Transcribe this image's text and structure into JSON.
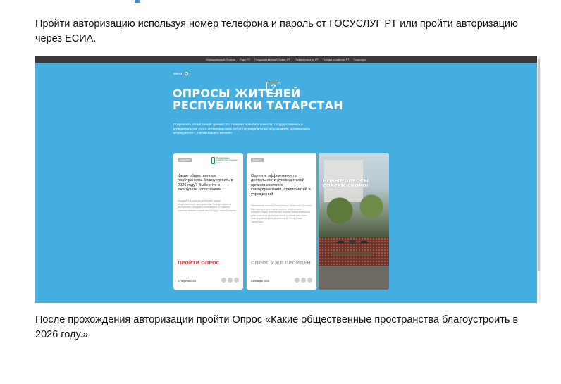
{
  "intro_text": "Пройти авторизацию используя номер телефона и пароль от ГОСУСЛУГ РТ или пройти авторизацию через ЕСИА.",
  "outro_text": "После прохождения авторизации пройти Опрос «Какие общественные пространства благоустроить в 2026 году.»",
  "site": {
    "nav": [
      "Официальный Портал",
      "Раис РТ",
      "Государственный Совет РТ",
      "Правительство РТ",
      "Города и районы РТ",
      "Госуслуги"
    ],
    "breadcrumb": "Меню",
    "title_line1": "ОПРОСЫ ЖИТЕЛЕЙ",
    "title_line2": "РЕСПУБЛИКИ ТАТАРСТАН",
    "bubble_icon_glyph": "?",
    "subtitle": "Поделитесь своей точкой зрения! Это поможет повысить качество государственных и муниципальных услуг, оптимизировать работу муниципальных образований, организовать мероприятия с учетом вашего мнения!"
  },
  "cards": [
    {
      "tag": "Госуслуги",
      "org": "Формирование комфортной городской среды",
      "title": "Какие общественные пространства благоустроить в 2026 году? Выберите в ежегодном голосовании.",
      "desc": "Каждый год жители выбирают, какие общественные пространства благоустроить в республике. Каждый голос важен: от вашего участия зависит, какие места будут преображены.",
      "cta": "ПРОЙТИ ОПРОС",
      "date": "21 апреля 2025"
    },
    {
      "tag": "Раис РТ",
      "title": "Оцените эффективность деятельности руководителей органов местного самоуправления, предприятий и учреждений",
      "desc": "Уважаемые жители Республики Татарстан! Просим Вас принять участие в опросе, результаты которого будут учтены при оценке эффективности деятельности руководителей органов местного самоуправления и организаций Республики Татарстан.",
      "cta": "ОПРОС УЖЕ ПРОЙДЕН",
      "date": "24 января 2025"
    }
  ],
  "promo": {
    "text": "НОВЫЕ ОПРОСЫ СОВСЕМ СКОРО!"
  },
  "colors": {
    "hero_bg": "#45aee0",
    "cta_active": "#e23a3a",
    "cta_done": "#a9a9a9",
    "nav_bg": "#3a3a3a"
  }
}
